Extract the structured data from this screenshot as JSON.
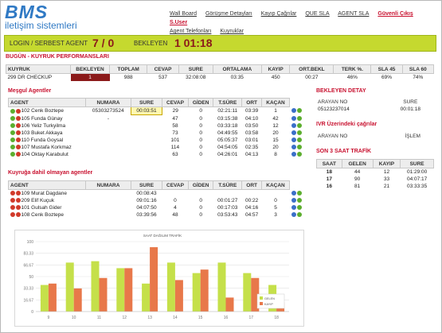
{
  "logo": {
    "brand": "BMS",
    "sub": "iletişim sistemleri"
  },
  "nav": {
    "row1": [
      "Wall Board",
      "Görüşme Detayları",
      "Kayıp Çağrılar",
      "QUE SLA",
      "AGENT SLA"
    ],
    "exit": "Güvenli Çıkış S.User",
    "row2": [
      "Agent Telefonları",
      "Kuyruklar"
    ]
  },
  "status": {
    "login_label": "LOGIN / SERBEST AGENT",
    "login_value": "7 / 0",
    "waiting_label": "BEKLEYEN",
    "waiting_value": "1 01:18"
  },
  "queue_perf": {
    "title": "BUGÜN - KUYRUK PERFORMANSLARI",
    "headers": [
      "KUYRUK",
      "BEKLEYEN",
      "TOPLAM",
      "CEVAP",
      "SURE",
      "ORTALAMA",
      "KAYIP",
      "ORT.BEKL",
      "TERK %.",
      "SLA 45",
      "SLA 60"
    ],
    "row": [
      "299 DR CHECKUP",
      "1",
      "988",
      "537",
      "32:08:08",
      "03:35",
      "450",
      "00:27",
      "46%",
      "69%",
      "74%"
    ]
  },
  "busy_agents": {
    "title": "Meşgul Agentler",
    "headers": [
      "AGENT",
      "NUMARA",
      "SURE",
      "CEVAP",
      "GİDEN",
      "T.SÜRE",
      "ORT",
      "KAÇAN"
    ],
    "rows": [
      [
        "102 Cenk Boztepe",
        "05303273524",
        "00:03:51",
        "29",
        "0",
        "02:21:11",
        "03:39",
        "1"
      ],
      [
        "105 Funda Günay",
        "-",
        "",
        "47",
        "0",
        "03:15:38",
        "04:10",
        "42"
      ],
      [
        "106 Yeliz Turkyilma",
        "",
        "",
        "58",
        "0",
        "03:33:18",
        "03:50",
        "12"
      ],
      [
        "103 Buket Akkaya",
        "",
        "",
        "73",
        "0",
        "04:49:55",
        "03:58",
        "20"
      ],
      [
        "110 Funda Goysal",
        "",
        "",
        "101",
        "0",
        "05:05:37",
        "03:01",
        "15"
      ],
      [
        "107 Mustafa Korkmaz",
        "",
        "",
        "114",
        "0",
        "04:54:05",
        "02:35",
        "20"
      ],
      [
        "104 Oktay Karabulut",
        "",
        "",
        "63",
        "0",
        "04:26:01",
        "04:13",
        "8"
      ]
    ]
  },
  "idle_agents": {
    "title": "Kuyruğa dahil olmayan agentler",
    "headers": [
      "AGENT",
      "NUMARA",
      "SURE",
      "CEVAP",
      "GİDEN",
      "T.SÜRE",
      "ORT",
      "KAÇAN"
    ],
    "rows": [
      [
        "109 Murat Dagdane",
        "",
        "00:08:43",
        "",
        "",
        "",
        "",
        ""
      ],
      [
        "209 Elif Kuçuk",
        "",
        "09:01:16",
        "0",
        "0",
        "00:01:27",
        "00:22",
        "0"
      ],
      [
        "101 Gulsah Gider",
        "",
        "04:07:50",
        "4",
        "0",
        "00:17:03",
        "04:16",
        "5"
      ],
      [
        "108 Cenk Boztepe",
        "",
        "03:39:56",
        "48",
        "0",
        "03:53:43",
        "04:57",
        "3"
      ]
    ]
  },
  "waiting_detail": {
    "title": "BEKLEYEN DETAY",
    "headers": [
      "ARAYAN NO",
      "SURE"
    ],
    "row": [
      "05123237014",
      "00:01:18"
    ]
  },
  "ivr": {
    "title": "IVR Üzerindeki çağrılar",
    "headers": [
      "ARAYAN NO",
      "İŞLEM"
    ]
  },
  "traffic": {
    "title": "SON 3 SAAT TRAFİK",
    "headers": [
      "SAAT",
      "GELEN",
      "KAYIP",
      "SURE"
    ],
    "rows": [
      [
        "18",
        "44",
        "12",
        "01:29:00"
      ],
      [
        "17",
        "90",
        "33",
        "04:07:17"
      ],
      [
        "16",
        "81",
        "21",
        "03:33:35"
      ]
    ]
  },
  "colors": {
    "accent_green": "#c5d92f",
    "red": "#c8102e",
    "dark_red": "#8b1a1a",
    "blue": "#2f79c4",
    "bar_green": "#c5e04a",
    "bar_orange": "#e8784a"
  },
  "chart_data": {
    "type": "bar",
    "title": "SAAT DAĞILIM TRAFİK",
    "categories": [
      "9",
      "10",
      "11",
      "12",
      "13",
      "14",
      "15",
      "16",
      "17",
      "18"
    ],
    "ylim": [
      0,
      100
    ],
    "yticks": [
      "0",
      "16.67",
      "33.33",
      "50",
      "66.67",
      "83.33",
      "100"
    ],
    "series": [
      {
        "name": "GELEN",
        "color": "#c5e04a",
        "values": [
          38,
          70,
          72,
          62,
          40,
          70,
          55,
          70,
          55,
          38
        ]
      },
      {
        "name": "KAYIP",
        "color": "#e8784a",
        "values": [
          40,
          33,
          48,
          62,
          92,
          45,
          60,
          20,
          48,
          13
        ]
      }
    ],
    "legend_position": "bottom-right"
  }
}
